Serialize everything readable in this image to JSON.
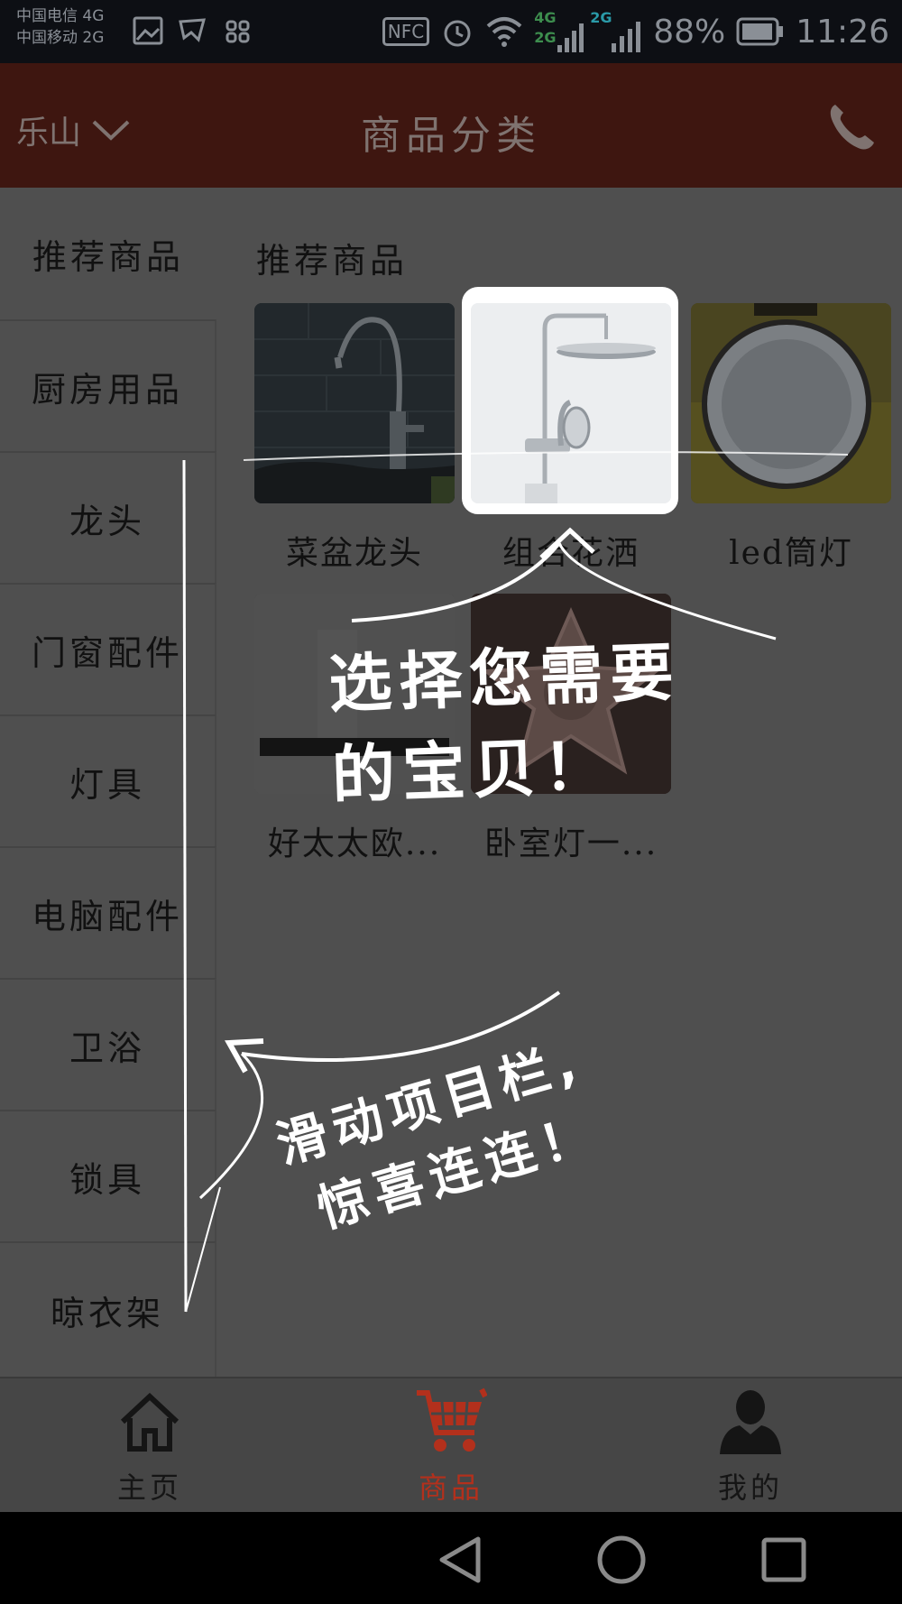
{
  "status_bar": {
    "carrier_1": "中国电信 4G",
    "carrier_2": "中国移动 2G",
    "nfc": "NFC",
    "net_1": "4G",
    "net_2": "2G",
    "net_3": "2G",
    "battery": "88%",
    "time": "11:26"
  },
  "header": {
    "city": "乐山",
    "title": "商品分类"
  },
  "sidebar": {
    "items": [
      {
        "label": "推荐商品"
      },
      {
        "label": "厨房用品"
      },
      {
        "label": "龙头"
      },
      {
        "label": "门窗配件"
      },
      {
        "label": "灯具"
      },
      {
        "label": "电脑配件"
      },
      {
        "label": "卫浴"
      },
      {
        "label": "锁具"
      },
      {
        "label": "晾衣架"
      }
    ]
  },
  "content": {
    "section_title": "推荐商品",
    "products": [
      {
        "name": "菜盆龙头"
      },
      {
        "name": "组合花洒"
      },
      {
        "name": "led筒灯"
      },
      {
        "name": "好太太欧..."
      },
      {
        "name": "卧室灯一..."
      }
    ]
  },
  "overlay": {
    "hint_top_line1": "选择您需要",
    "hint_top_line2": "的宝贝！",
    "hint_bottom_line1": "滑动项目栏,",
    "hint_bottom_line2": "惊喜连连！"
  },
  "tabbar": {
    "tabs": [
      {
        "label": "主页",
        "icon": "home-icon"
      },
      {
        "label": "商品",
        "icon": "cart-icon"
      },
      {
        "label": "我的",
        "icon": "user-icon"
      }
    ],
    "active_color": "#b3301c",
    "inactive_color": "#151515"
  }
}
